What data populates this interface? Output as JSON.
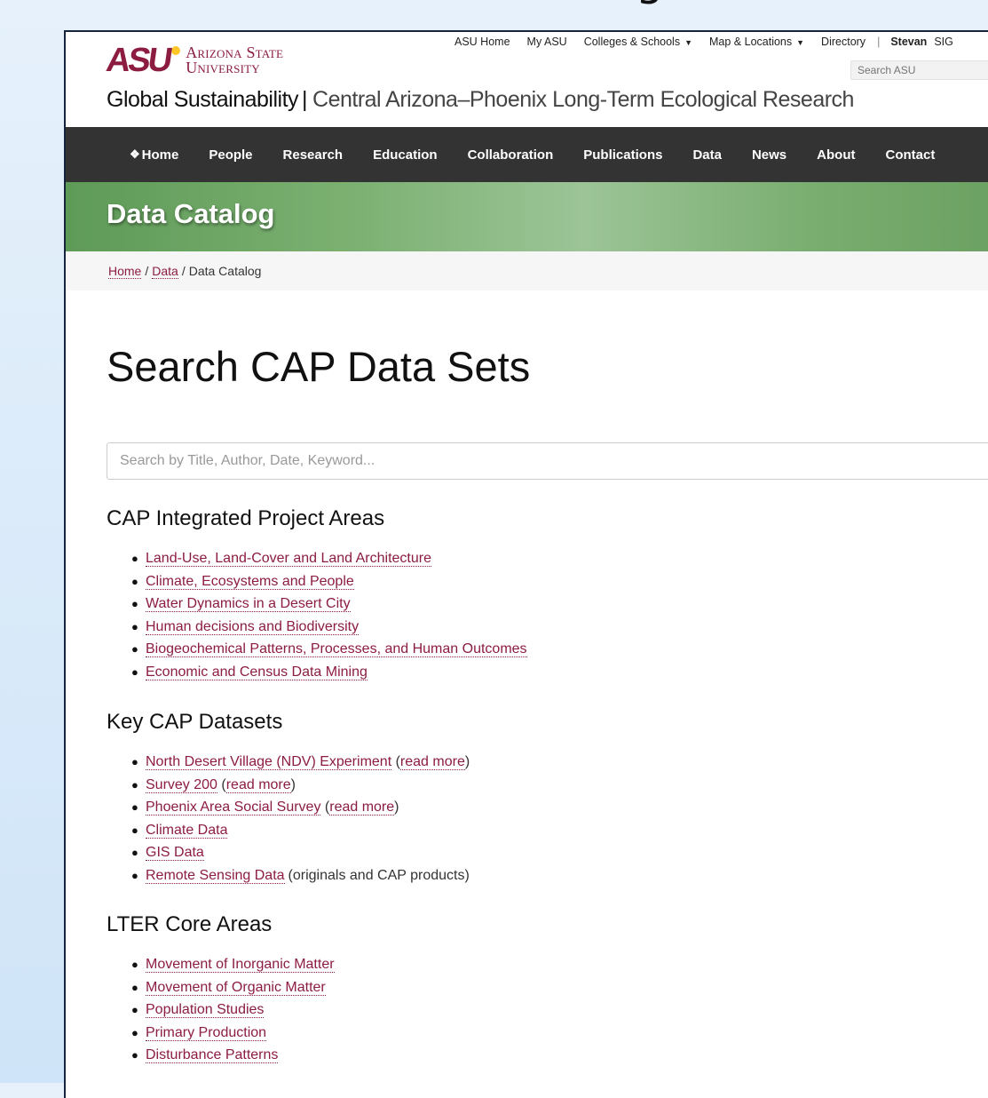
{
  "header": {
    "logo": {
      "mark": "ASU",
      "line1": "Arizona State",
      "line2": "University"
    },
    "top_links": [
      {
        "label": "ASU Home",
        "dropdown": false
      },
      {
        "label": "My ASU",
        "dropdown": false
      },
      {
        "label": "Colleges & Schools",
        "dropdown": true
      },
      {
        "label": "Map & Locations",
        "dropdown": true
      },
      {
        "label": "Directory",
        "dropdown": false
      }
    ],
    "separator": "|",
    "user": "Stevan",
    "sign_label": "SIG",
    "search_placeholder": "Search ASU",
    "site_title": {
      "primary": "Global Sustainability",
      "separator": "|",
      "secondary": "Central Arizona–Phoenix Long-Term Ecological Research"
    }
  },
  "nav": {
    "items": [
      "Home",
      "People",
      "Research",
      "Education",
      "Collaboration",
      "Publications",
      "Data",
      "News",
      "About",
      "Contact"
    ]
  },
  "hero": {
    "title": "Data Catalog"
  },
  "breadcrumb": {
    "items": [
      "Home",
      "Data"
    ],
    "separator": "/",
    "current": "Data Catalog"
  },
  "main": {
    "heading": "Search CAP Data Sets",
    "search_placeholder": "Search by Title, Author, Date, Keyword...",
    "sections": [
      {
        "title": "CAP Integrated Project Areas",
        "items": [
          {
            "label": "Land-Use, Land-Cover and Land Architecture"
          },
          {
            "label": "Climate, Ecosystems and People"
          },
          {
            "label": "Water Dynamics in a Desert City"
          },
          {
            "label": "Human decisions and Biodiversity"
          },
          {
            "label": "Biogeochemical Patterns, Processes, and Human Outcomes"
          },
          {
            "label": "Economic and Census Data Mining"
          }
        ]
      },
      {
        "title": "Key CAP Datasets",
        "items": [
          {
            "label": "North Desert Village (NDV) Experiment",
            "extra_link": "read more"
          },
          {
            "label": "Survey 200",
            "extra_link": "read more"
          },
          {
            "label": "Phoenix Area Social Survey",
            "extra_link": "read more"
          },
          {
            "label": "Climate Data"
          },
          {
            "label": "GIS Data"
          },
          {
            "label": "Remote Sensing Data",
            "note": "(originals and CAP products)"
          }
        ]
      },
      {
        "title": "LTER Core Areas",
        "items": [
          {
            "label": "Movement of Inorganic Matter"
          },
          {
            "label": "Movement of Organic Matter"
          },
          {
            "label": "Population Studies"
          },
          {
            "label": "Primary Production"
          },
          {
            "label": "Disturbance Patterns"
          }
        ]
      }
    ]
  },
  "colors": {
    "maroon": "#8c1d40",
    "gold": "#ffc627",
    "nav_bg": "#333333",
    "hero_green": "#7bb071"
  }
}
